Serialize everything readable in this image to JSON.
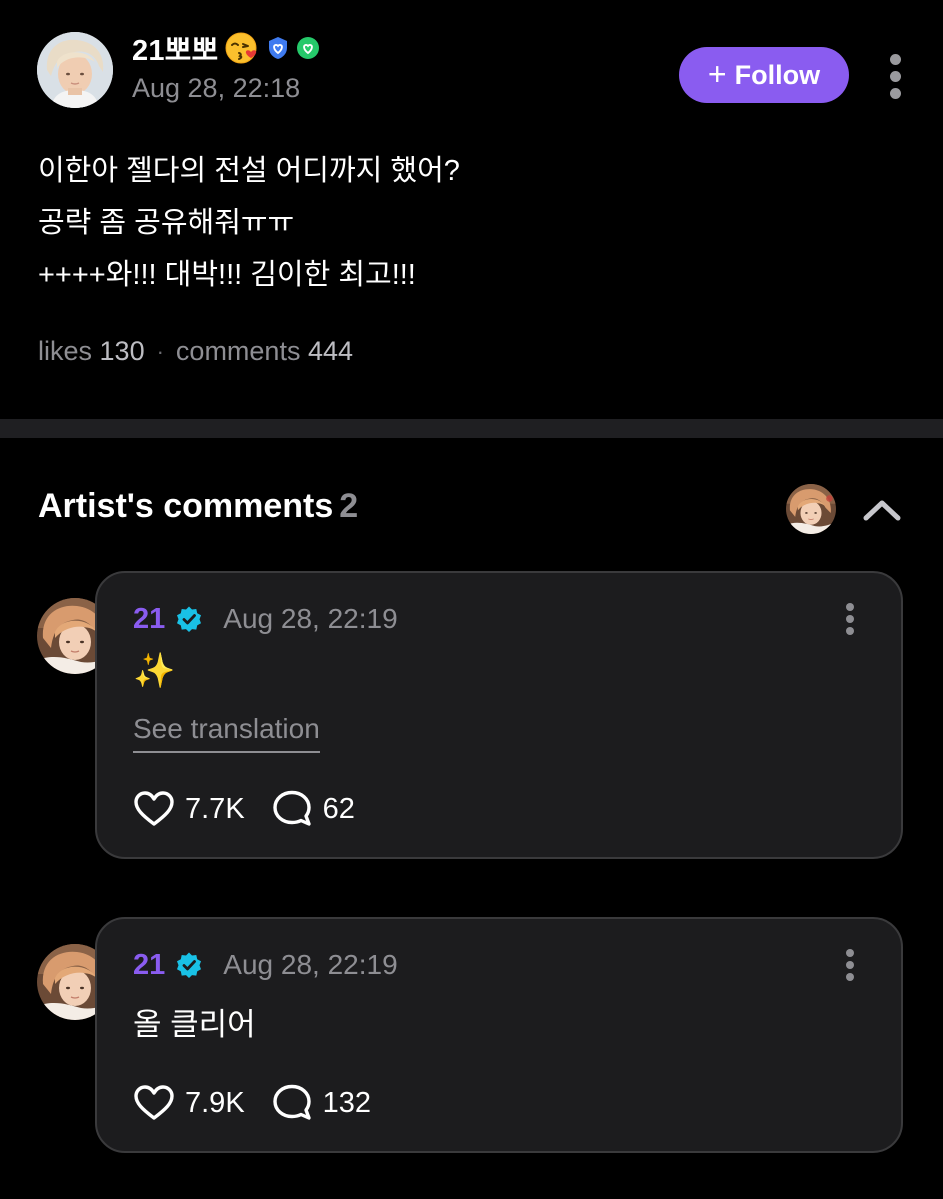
{
  "post": {
    "author_name": "21뽀뽀",
    "author_emoji": "kissing-face-emoji",
    "badges": [
      "blue-shield-heart-badge",
      "green-shield-heart-badge"
    ],
    "timestamp": "Aug 28, 22:18",
    "follow_label": "Follow",
    "body_lines": [
      "이한아 젤다의 전설 어디까지 했어?",
      "공략 좀 공유해줘ㅠㅠ",
      "++++와!!! 대박!!! 김이한 최고!!!"
    ],
    "likes_label": "likes",
    "likes_count": "130",
    "comments_label": "comments",
    "comments_count": "444",
    "separator": "·"
  },
  "artist_comments": {
    "title": "Artist's comments",
    "count": "2",
    "items": [
      {
        "author": "21",
        "verified": true,
        "timestamp": "Aug 28, 22:19",
        "text": "✨",
        "translation_label": "See translation",
        "likes": "7.7K",
        "replies": "62"
      },
      {
        "author": "21",
        "verified": true,
        "timestamp": "Aug 28, 22:19",
        "text": "올 클리어",
        "likes": "7.9K",
        "replies": "132"
      }
    ]
  },
  "colors": {
    "background": "#000000",
    "accent_purple": "#8a5cf0",
    "verified_cyan": "#19c1e6",
    "muted_text": "#8e8e93",
    "card_background": "#1c1c1e",
    "card_border": "#3a3a3c"
  },
  "icons": {
    "more": "kebab-vertical-icon",
    "collapse": "chevron-up-icon",
    "like": "heart-outline-icon",
    "reply": "speech-bubble-icon",
    "add": "plus-icon"
  }
}
